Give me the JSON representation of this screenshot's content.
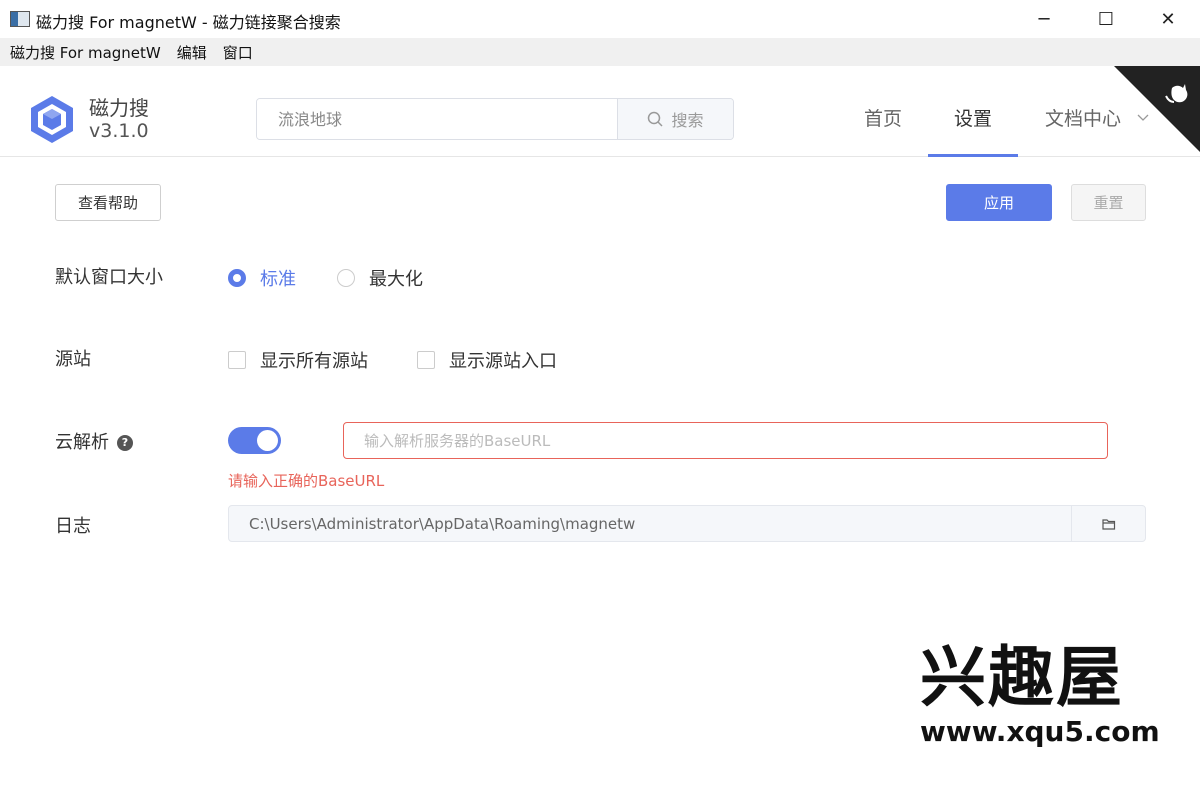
{
  "window": {
    "title": "磁力搜 For magnetW - 磁力链接聚合搜索",
    "minimize": "─",
    "maximize": "☐",
    "close": "✕"
  },
  "menubar": {
    "items": [
      "磁力搜 For magnetW",
      "编辑",
      "窗口"
    ]
  },
  "header": {
    "brand_name": "磁力搜",
    "version": "v3.1.0",
    "search": {
      "value": "",
      "placeholder": "流浪地球",
      "button_label": "搜索"
    },
    "nav": {
      "home": "首页",
      "settings": "设置",
      "docs": "文档中心",
      "active": "settings"
    },
    "accent_color": "#5b7be8"
  },
  "toolbar": {
    "help_label": "查看帮助",
    "apply_label": "应用",
    "reset_label": "重置"
  },
  "settings": {
    "window_size": {
      "label": "默认窗口大小",
      "options": [
        "标准",
        "最大化"
      ],
      "selected": "标准"
    },
    "sources": {
      "label": "源站",
      "show_all": {
        "label": "显示所有源站",
        "checked": false
      },
      "show_entry": {
        "label": "显示源站入口",
        "checked": false
      }
    },
    "cloud_parse": {
      "label": "云解析",
      "enabled": true,
      "input_placeholder": "输入解析服务器的BaseURL",
      "input_value": "",
      "error": "请输入正确的BaseURL",
      "error_color": "#e8645a"
    },
    "log": {
      "label": "日志",
      "path": "C:\\Users\\Administrator\\AppData\\Roaming\\magnetw"
    }
  },
  "watermark": {
    "title": "兴趣屋",
    "url": "www.xqu5.com"
  }
}
